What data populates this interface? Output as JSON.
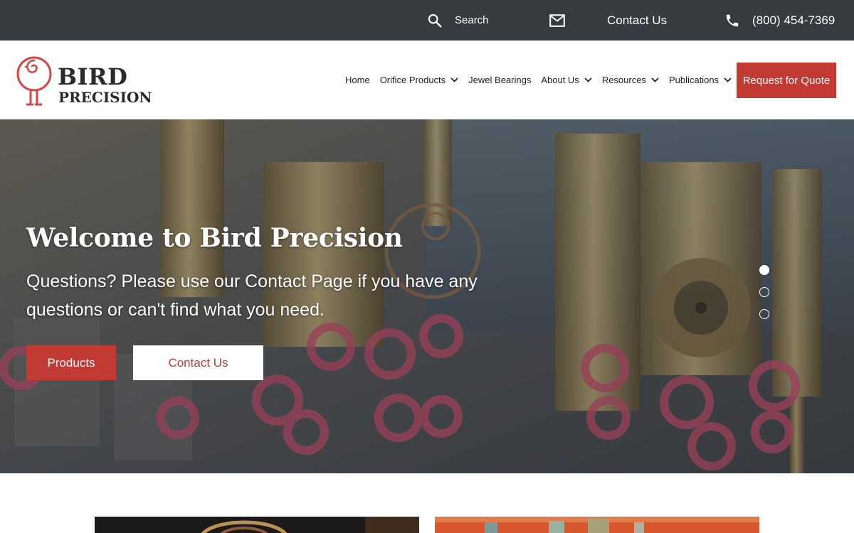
{
  "topbar": {
    "search_label": "Search",
    "contact_label": "Contact Us",
    "phone": "(800) 454-7369"
  },
  "logo": {
    "line1": "BIRD",
    "line2": "PRECISION"
  },
  "nav": {
    "items": [
      {
        "label": "Home"
      },
      {
        "label": "Orifice Products"
      },
      {
        "label": "Jewel Bearings"
      },
      {
        "label": "About Us"
      },
      {
        "label": "Resources"
      },
      {
        "label": "Publications"
      }
    ],
    "cta_label": "Request for Quote"
  },
  "hero": {
    "title": "Welcome to Bird Precision",
    "subtitle": "Questions? Please use our Contact Page if you have any questions or can't find what you need.",
    "primary_button": "Products",
    "secondary_button": "Contact Us",
    "active_slide": 1,
    "slide_count": 3
  },
  "colors": {
    "topbar_bg": "#353b3f",
    "brand_red": "#c23a34",
    "logo_red": "#d94545",
    "text_dark": "#222222"
  },
  "icons": {
    "search": "search-icon",
    "mail": "mail-icon",
    "phone": "phone-icon",
    "chevron": "chevron-down-icon",
    "logo": "bird-logo-icon"
  }
}
